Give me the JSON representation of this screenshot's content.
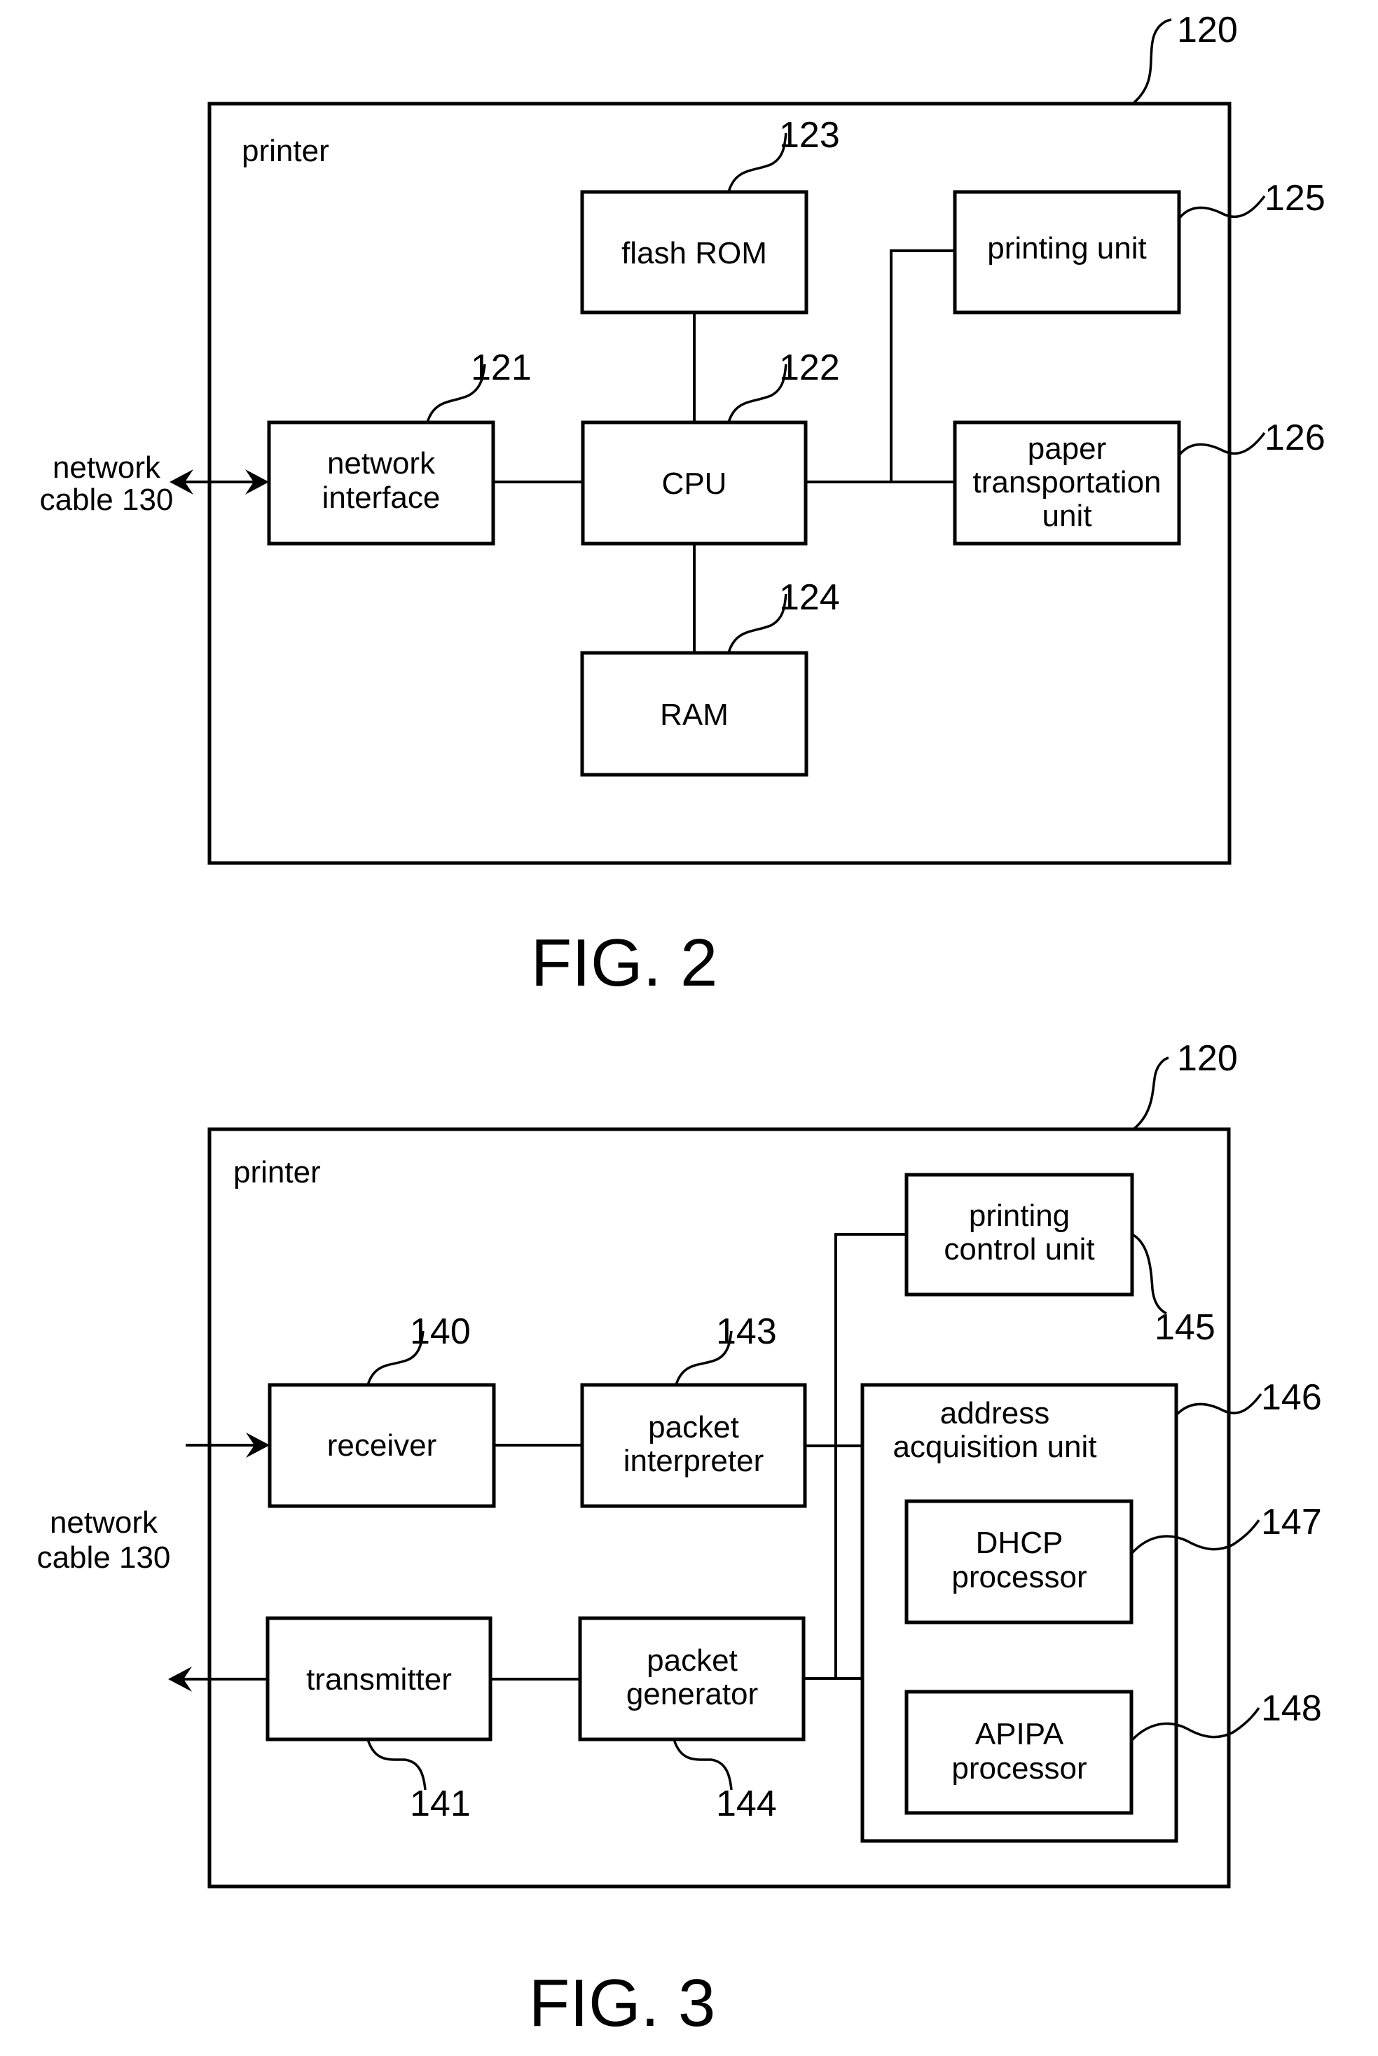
{
  "fig2": {
    "caption": "FIG. 2",
    "container": {
      "title": "printer",
      "ref": "120"
    },
    "external": {
      "line1": "network",
      "line2": "cable 130"
    },
    "blocks": {
      "network_interface": {
        "lines": [
          "network",
          "interface"
        ],
        "ref": "121"
      },
      "cpu": {
        "lines": [
          "CPU"
        ],
        "ref": "122"
      },
      "flash_rom": {
        "lines": [
          "flash ROM"
        ],
        "ref": "123"
      },
      "ram": {
        "lines": [
          "RAM"
        ],
        "ref": "124"
      },
      "printing_unit": {
        "lines": [
          "printing unit"
        ],
        "ref": "125"
      },
      "paper_transportation_unit": {
        "lines": [
          "paper",
          "transportation",
          "unit"
        ],
        "ref": "126"
      }
    }
  },
  "fig3": {
    "caption": "FIG. 3",
    "container": {
      "title": "printer",
      "ref": "120"
    },
    "external": {
      "line1": "network",
      "line2": "cable 130"
    },
    "blocks": {
      "receiver": {
        "lines": [
          "receiver"
        ],
        "ref": "140"
      },
      "transmitter": {
        "lines": [
          "transmitter"
        ],
        "ref": "141"
      },
      "packet_interpreter": {
        "lines": [
          "packet",
          "interpreter"
        ],
        "ref": "143"
      },
      "packet_generator": {
        "lines": [
          "packet",
          "generator"
        ],
        "ref": "144"
      },
      "printing_control_unit": {
        "lines": [
          "printing",
          "control unit"
        ],
        "ref": "145"
      },
      "address_acquisition_unit": {
        "lines": [
          "address",
          "acquisition unit"
        ],
        "ref": "146"
      },
      "dhcp_processor": {
        "lines": [
          "DHCP",
          "processor"
        ],
        "ref": "147"
      },
      "apipa_processor": {
        "lines": [
          "APIPA",
          "processor"
        ],
        "ref": "148"
      }
    }
  }
}
